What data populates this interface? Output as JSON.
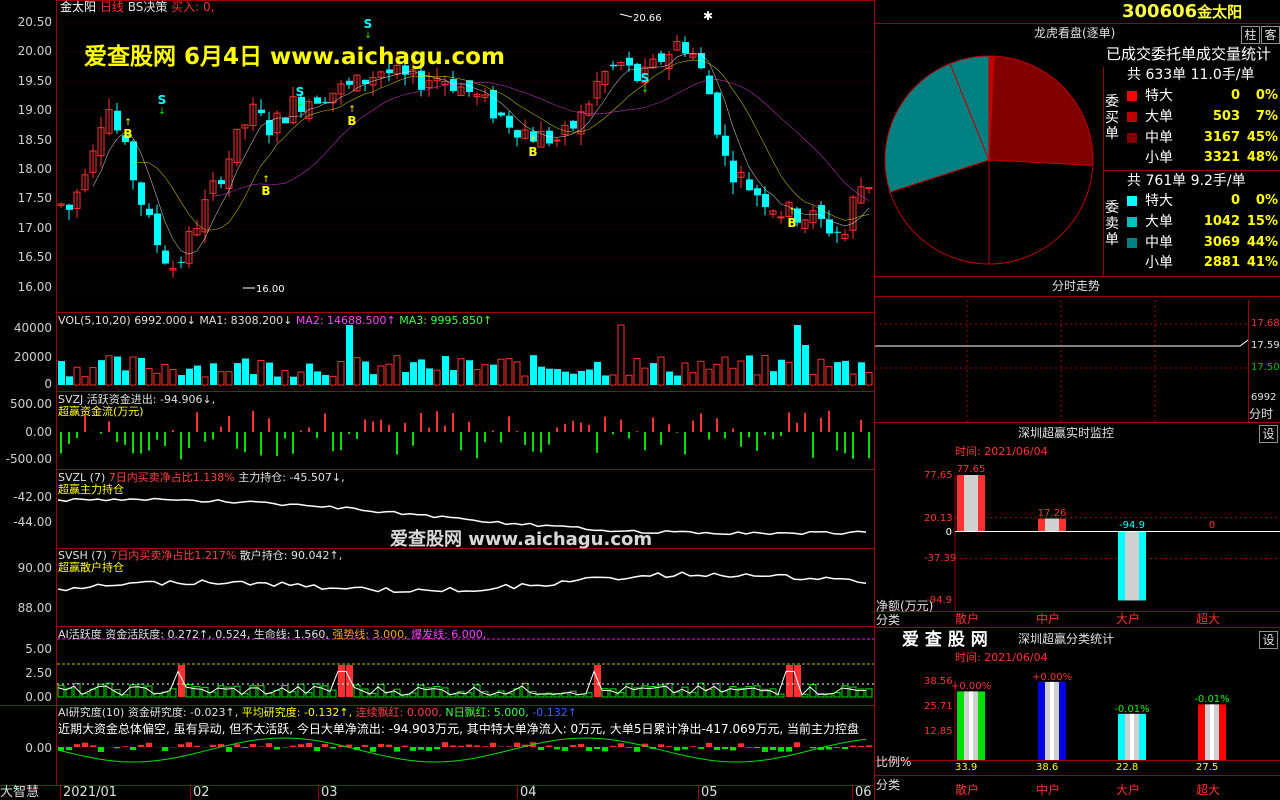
{
  "chart": {
    "header": {
      "stock_name": "金太阳",
      "period": "日线",
      "indicator": "BS决策",
      "signal": "买入: 0,"
    },
    "watermark_top": "爱查股网    6月4日    www.aichagu.com",
    "watermark_mid": "爱查股网    www.aichagu.com",
    "price_axis": [
      "20.50",
      "20.00",
      "19.50",
      "19.00",
      "18.50",
      "18.00",
      "17.50",
      "17.00",
      "16.50",
      "16.00"
    ],
    "high_label": "20.66",
    "low_label": "16.00",
    "buy_mark": "B",
    "sell_mark": "S",
    "vol": {
      "label": "VOL(5,10,20)",
      "value": "6992.000↓",
      "ma1": "MA1: 8308.200↓",
      "ma2": "MA2: 14688.500↑",
      "ma3": "MA3: 9995.850↑",
      "axis": [
        "40000",
        "20000",
        "0"
      ]
    },
    "svzj": {
      "label": "SVZJ",
      "text": "活跃资金进出: -94.906↓,",
      "title": "超赢资金流(万元)",
      "axis": [
        "500.00",
        "0.00",
        "-500.00"
      ]
    },
    "svzl": {
      "label": "SVZL (7)",
      "ratio": "7日内买卖净占比1.138%",
      "hold": "主力持仓: -45.507↓,",
      "title": "超赢主力持仓",
      "axis": [
        "-42.00",
        "-44.00"
      ]
    },
    "svsh": {
      "label": "SVSH (7)",
      "ratio": "7日内买卖净占比1.217%",
      "hold": "散户持仓: 90.042↑,",
      "title": "超赢散户持仓",
      "axis": [
        "90.00",
        "88.00"
      ]
    },
    "ai_active": {
      "label": "AI活跃度",
      "v1": "资金活跃度: 0.272↑,",
      "v2": "0.524,",
      "v3": "生命线: 1.560,",
      "v4": "强势线: 3.000,",
      "v5": "爆发线: 6.000,",
      "axis": [
        "5.00",
        "2.50",
        "0.00"
      ]
    },
    "ai_research": {
      "label": "AI研究度(10)",
      "v1": "资金研究度: -0.023↑,",
      "v2": "平均研究度: -0.132↑,",
      "v3": "连续飘红: 0.000,",
      "v4": "N日飘红: 5.000,",
      "v5": "-0.132↑",
      "axis": [
        "0.00"
      ],
      "comment": "近期大资金总体偏空, 虽有异动, 但不太活跃, 今日大单净流出: -94.903万元, 其中特大单净流入: 0万元, 大单5日累计净出-417.069万元, 当前主力控盘"
    },
    "x_axis": [
      "2021/01",
      "02",
      "03",
      "04",
      "05",
      "06"
    ],
    "corner_label": "大智慧"
  },
  "right": {
    "code": "300606",
    "name": "金太阳",
    "btn_zhu": "柱",
    "btn_ke": "客",
    "lhb_title": "龙虎看盘(逐单)",
    "stats_title": "已成交委托单成交量统计",
    "buy": {
      "total": "共 633单 11.0手/单",
      "side_label": "委买单",
      "rows": [
        {
          "name": "特大",
          "count": "0",
          "pct": "0%",
          "color": "#ff0000"
        },
        {
          "name": "大单",
          "count": "503",
          "pct": "7%",
          "color": "#c00000"
        },
        {
          "name": "中单",
          "count": "3167",
          "pct": "45%",
          "color": "#800000"
        },
        {
          "name": "小单",
          "count": "3321",
          "pct": "48%",
          "color": "#000000"
        }
      ]
    },
    "sell": {
      "total": "共 761单 9.2手/单",
      "side_label": "委卖单",
      "rows": [
        {
          "name": "特大",
          "count": "0",
          "pct": "0%",
          "color": "#00ffff"
        },
        {
          "name": "大单",
          "count": "1042",
          "pct": "15%",
          "color": "#00c0c0"
        },
        {
          "name": "中单",
          "count": "3069",
          "pct": "44%",
          "color": "#008080"
        },
        {
          "name": "小单",
          "count": "2881",
          "pct": "41%",
          "color": "#000000"
        }
      ]
    },
    "fenshi": {
      "title": "分时走势",
      "axis": [
        "17.68",
        "17.59",
        "17.50"
      ],
      "vol": "6992",
      "footer": "分时"
    },
    "monitor": {
      "title": "深圳超赢实时监控",
      "btn": "设",
      "time": "时间: 2021/06/04",
      "axis": [
        "77.65",
        "20.13",
        "0",
        "-37.39",
        "-94.9"
      ],
      "y_label": "净额(万元)",
      "x_label": "分类",
      "bars": [
        {
          "name": "散户",
          "value": "77.65",
          "num": 77.65
        },
        {
          "name": "中户",
          "value": "17.26",
          "num": 17.26
        },
        {
          "name": "大户",
          "value": "-94.9",
          "num": -94.9
        },
        {
          "name": "超大",
          "value": "0",
          "num": 0
        }
      ]
    },
    "classify": {
      "logo": "爱 查 股 网",
      "title": "深圳超赢分类统计",
      "btn": "设",
      "time": "时间: 2021/06/04",
      "axis": [
        "38.56",
        "25.71",
        "12.85",
        "0"
      ],
      "y_label": "比例%",
      "x_label": "分类",
      "bars": [
        {
          "name": "散户",
          "value": "33.9",
          "delta": "+0.00%",
          "num": 33.9,
          "color": "#00e000"
        },
        {
          "name": "中户",
          "value": "38.6",
          "delta": "+0.00%",
          "num": 38.6,
          "color": "#0000e0"
        },
        {
          "name": "大户",
          "value": "22.8",
          "delta": "-0.01%",
          "num": 22.8,
          "color": "#00ffff"
        },
        {
          "name": "超大",
          "value": "27.5",
          "delta": "-0.01%",
          "num": 27.5,
          "color": "#ff0000"
        }
      ]
    }
  }
}
